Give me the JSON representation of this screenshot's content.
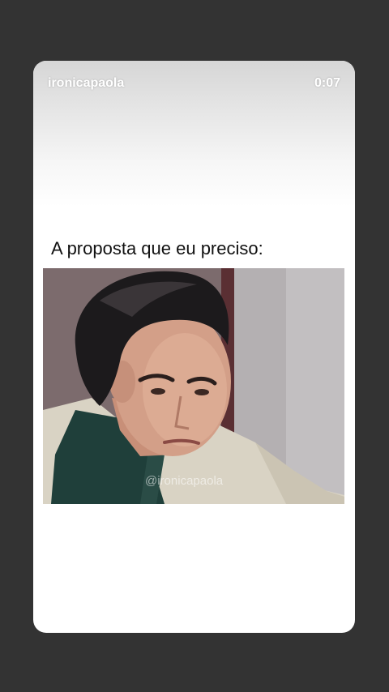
{
  "story": {
    "username": "ironicapaola",
    "time": "0:07"
  },
  "post": {
    "caption": "A proposta que eu preciso:",
    "watermark": "@ironicapaola"
  }
}
